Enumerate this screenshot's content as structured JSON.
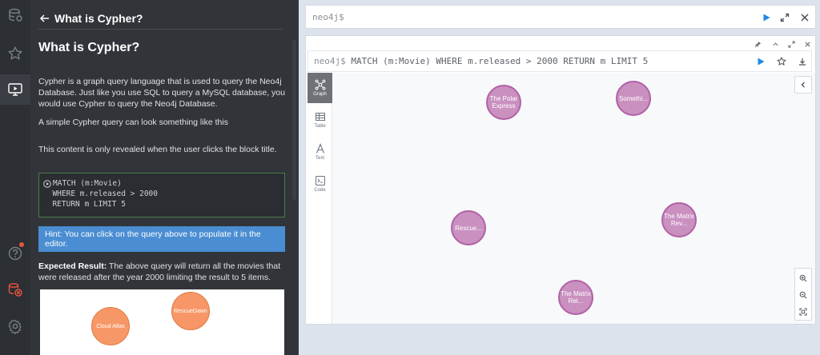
{
  "rail": {
    "items": [
      {
        "icon": "database-icon"
      },
      {
        "icon": "star-icon"
      },
      {
        "icon": "monitor-play-icon"
      },
      {
        "icon": "help-icon"
      },
      {
        "icon": "disconnected-icon"
      },
      {
        "icon": "gear-icon"
      }
    ]
  },
  "guide": {
    "header_title": "What is Cypher?",
    "heading": "What is Cypher?",
    "intro": "Cypher is a graph query language that is used to query the Neo4j Database. Just like you use SQL to query a MySQL database, you would use Cypher to query the Neo4j Database.",
    "simple": "A simple Cypher query can look something like this",
    "reveal": "This content is only revealed when the user clicks the block title.",
    "code": {
      "line1": "MATCH (m:Movie)",
      "line2": "  WHERE m.released > 2000",
      "line3": "  RETURN m LIMIT 5"
    },
    "hint": "Hint: You can click on the query above to populate it in the editor.",
    "expected_label": "Expected Result:",
    "expected_text": " The above query will return all the movies that were released after the year 2000 limiting the result to 5 items.",
    "result_nodes": [
      "Cloud Atlas",
      "RescueDawn"
    ]
  },
  "editor": {
    "prompt": "neo4j$"
  },
  "frame": {
    "prompt": "neo4j$",
    "query": " MATCH (m:Movie) WHERE m.released > 2000 RETURN m LIMIT 5",
    "tabs": [
      {
        "label": "Graph",
        "icon": "graph-icon"
      },
      {
        "label": "Table",
        "icon": "table-icon"
      },
      {
        "label": "Text",
        "icon": "text-icon"
      },
      {
        "label": "Code",
        "icon": "code-icon"
      }
    ],
    "nodes": [
      "The Polar Express",
      "Somethi...",
      "Rescue...",
      "The Matrix Rev...",
      "The Matrix Rel..."
    ]
  },
  "colors": {
    "movie_node": "#c990c0",
    "orange_node": "#f79767",
    "hint_bg": "#4a8dd2",
    "accent_play": "#1e88e5"
  }
}
